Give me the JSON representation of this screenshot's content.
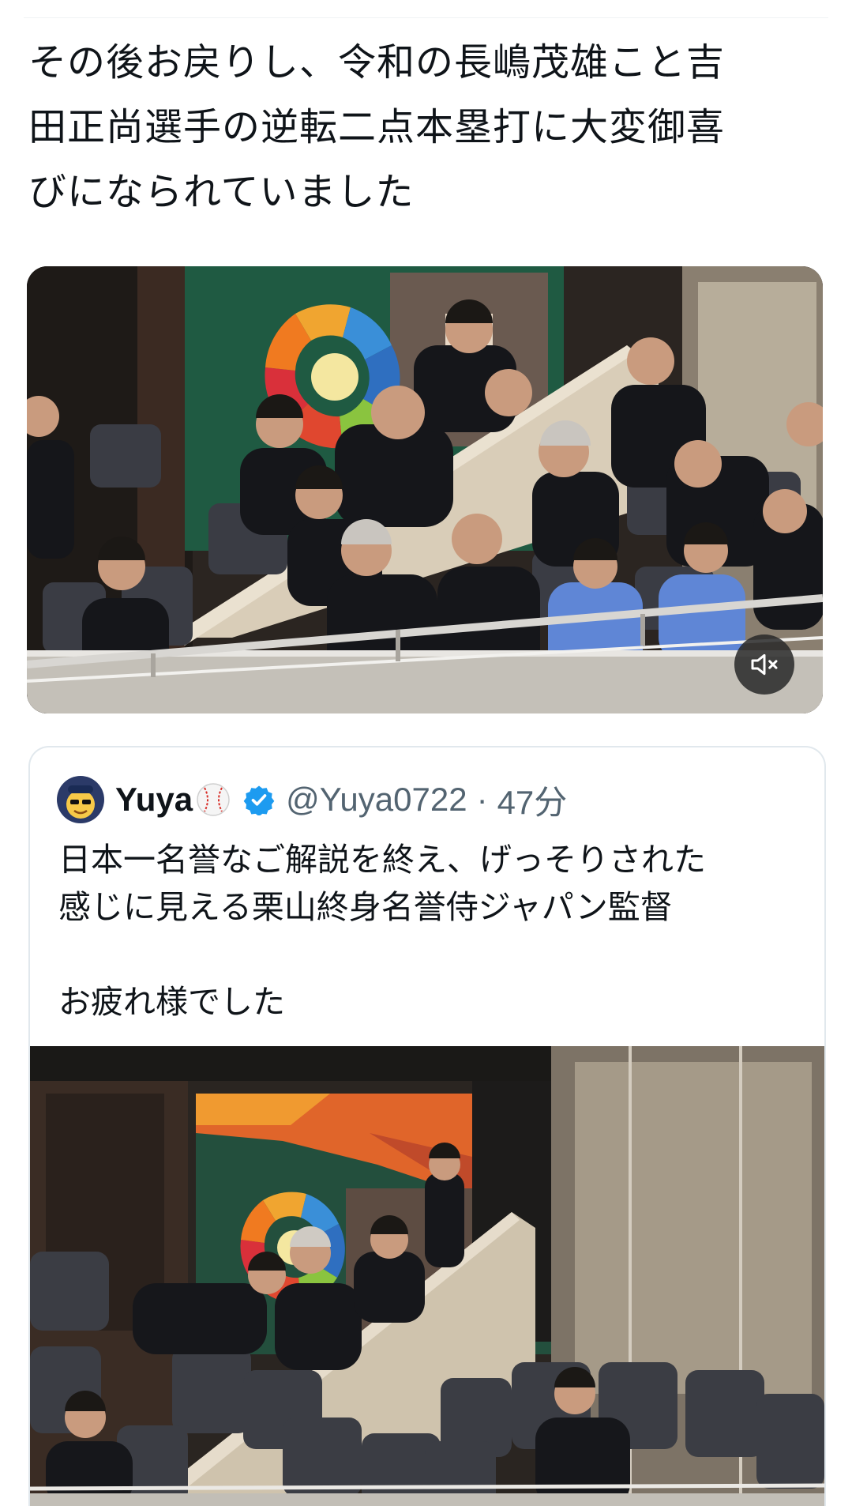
{
  "tweet": {
    "text": "その後お戻りし、令和の長嶋茂雄こと吉\n田正尚選手の逆転二点本塁打に大変御喜\nびになられていました"
  },
  "video": {
    "mute_icon": "speaker-muted-icon"
  },
  "quoted_tweet": {
    "display_name": "Yuya",
    "name_emoji": "baseball-icon",
    "verified_icon": "verified-badge-icon",
    "handle": "@Yuya0722",
    "separator": "·",
    "time": "47分",
    "text": "日本一名誉なご解説を終え、げっそりされた\n感じに見える栗山終身名誉侍ジャパン監督\n\nお疲れ様でした"
  },
  "colors": {
    "text": "#0f1419",
    "secondary": "#536471",
    "verified": "#1d9bf0",
    "border": "#e1e8ed"
  }
}
